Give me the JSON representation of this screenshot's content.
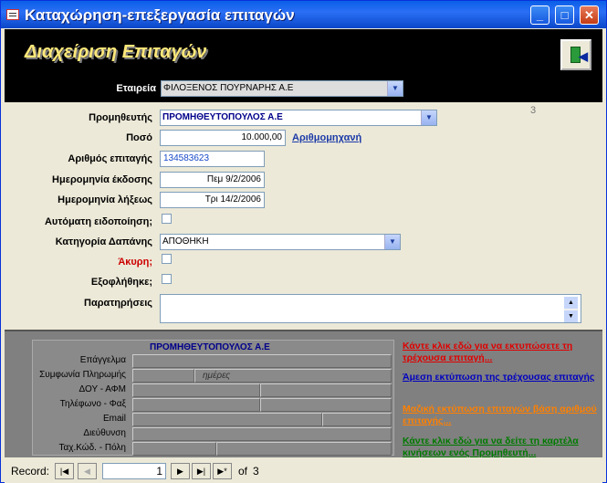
{
  "window": {
    "title": "Καταχώρηση-επεξεργασία επιταγών"
  },
  "header": {
    "title": "Διαχείριση Επιταγών",
    "company_label": "Εταιρεία",
    "company_value": "ΦΙΛΟΞΕΝΟΣ ΠΟΥΡΝΑΡΗΣ Α.Ε"
  },
  "form": {
    "supplier_label": "Προμηθευτής",
    "supplier_value": "ΠΡΟΜΗΘΕΥΤΟΠΟΥΛΟΣ Α.Ε",
    "record_id": "3",
    "amount_label": "Ποσό",
    "amount_value": "10.000,00",
    "calculator_link": "Αριθμομηχανή",
    "check_number_label": "Αριθμός επιταγής",
    "check_number_value": "134583623",
    "issue_date_label": "Ημερομηνία έκδοσης",
    "issue_date_value": "Πεμ 9/2/2006",
    "expiry_date_label": "Ημερομηνία λήξεως",
    "expiry_date_value": "Τρι 14/2/2006",
    "auto_notify_label": "Αυτόματη ειδοποίηση;",
    "category_label": "Κατηγορία Δαπάνης",
    "category_value": "ΑΠΟΘΗΚΗ",
    "void_label": "Άκυρη;",
    "paid_label": "Εξοφλήθηκε;",
    "notes_label": "Παρατηρήσεις"
  },
  "supplier_info": {
    "title": "ΠΡΟΜΗΘΕΥΤΟΠΟΥΛΟΣ Α.Ε",
    "rows": [
      "Επάγγελμα",
      "Συμφωνία Πληρωμής",
      "ΔΟΥ - ΑΦΜ",
      "Τηλέφωνο - Φαξ",
      "Email",
      "Διεύθυνση",
      "Ταχ.Κώδ. - Πόλη"
    ],
    "days_text": "ημέρες"
  },
  "links": {
    "print_current": "Κάντε κλικ εδώ για να εκτυπώσετε τη τρέχουσα επιταγή...",
    "direct_print": "Άμεση εκτύπωση της τρέχουσας επιταγής",
    "bulk_print": "Μαζική εκτύπωση επιταγών βάση αριθμού επιταγής...",
    "supplier_card": "Κάντε κλικ εδώ για να δείτε τη καρτέλα κινήσεων ενός Προμηθευτή..."
  },
  "colors": {
    "print_current": "#e00000",
    "direct_print": "#0000c0",
    "bulk_print": "#ff8000",
    "supplier_card": "#007a00"
  },
  "record_bar": {
    "label": "Record:",
    "current": "1",
    "of_text": "of",
    "total": "3"
  }
}
